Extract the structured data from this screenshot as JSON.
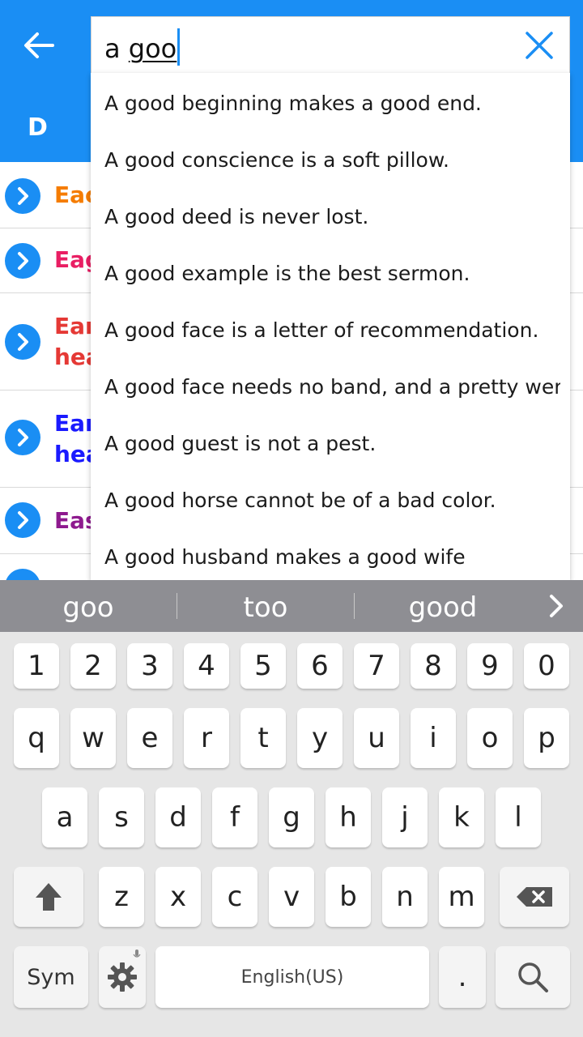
{
  "search": {
    "query_prefix": "a ",
    "query_word": "goo"
  },
  "tab": {
    "label": "D"
  },
  "list_rows": [
    {
      "text": "Eac",
      "color": "#f57c00"
    },
    {
      "text": "Eag",
      "color": "#e91e63"
    },
    {
      "text": "Ear",
      "text2": "hea",
      "color": "#e53935"
    },
    {
      "text": "Ear",
      "text2": "hea",
      "color": "#1a1aff"
    },
    {
      "text": "Eas",
      "color": "#8e1a8e"
    }
  ],
  "suggestions": [
    "A good beginning makes a good end.",
    "A good conscience is a soft pillow.",
    "A good deed is never lost.",
    "A good example is the best sermon.",
    "A good face is a letter of recommendation.",
    "A good face needs no band, and a pretty wench",
    "A good guest is not a pest.",
    "A good horse cannot be of a bad color.",
    "A good husband makes a good wife"
  ],
  "keyboard": {
    "predictions": [
      "goo",
      "too",
      "good"
    ],
    "row_numbers": [
      "1",
      "2",
      "3",
      "4",
      "5",
      "6",
      "7",
      "8",
      "9",
      "0"
    ],
    "row_1": [
      "q",
      "w",
      "e",
      "r",
      "t",
      "y",
      "u",
      "i",
      "o",
      "p"
    ],
    "row_2": [
      "a",
      "s",
      "d",
      "f",
      "g",
      "h",
      "j",
      "k",
      "l"
    ],
    "row_3": [
      "z",
      "x",
      "c",
      "v",
      "b",
      "n",
      "m"
    ],
    "sym_label": "Sym",
    "space_label": "English(US)",
    "period_label": "."
  },
  "colors": {
    "primary": "#1a8ef4",
    "prediction_bar": "#8e8e93"
  }
}
